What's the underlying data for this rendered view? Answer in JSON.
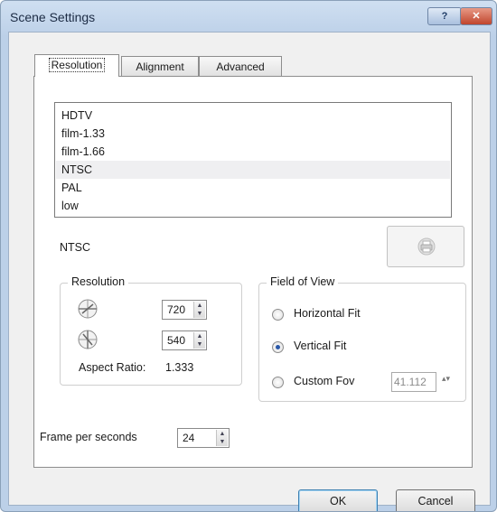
{
  "window": {
    "title": "Scene Settings",
    "help_label": "?",
    "close_label": "✕"
  },
  "tabs": [
    {
      "label": "Resolution",
      "selected": true
    },
    {
      "label": "Alignment",
      "selected": false
    },
    {
      "label": "Advanced",
      "selected": false
    }
  ],
  "presets": {
    "items": [
      "HDTV",
      "film-1.33",
      "film-1.66",
      "NTSC",
      "PAL",
      "low"
    ],
    "selected": "NTSC"
  },
  "selected_preset_name": "NTSC",
  "render_button_icon": "printer-icon",
  "resolution_group": {
    "legend": "Resolution",
    "width_icon": "horizontal-dial-icon",
    "height_icon": "vertical-dial-icon",
    "width": "720",
    "height": "540",
    "aspect_ratio_label": "Aspect Ratio:",
    "aspect_ratio_value": "1.333"
  },
  "fov_group": {
    "legend": "Field of View",
    "options": [
      "Horizontal Fit",
      "Vertical Fit",
      "Custom Fov"
    ],
    "selected": "Vertical Fit",
    "custom_fov_value": "41.112",
    "custom_fov_arrows": "▴▾"
  },
  "frame_rate": {
    "label": "Frame per seconds",
    "value": "24"
  },
  "spin_arrows": {
    "up": "▲",
    "down": "▼"
  },
  "buttons": {
    "ok": "OK",
    "cancel": "Cancel"
  },
  "colors": {
    "accent": "#2a58a8",
    "selection": "#efeff1",
    "title_bar": "#bcd0e8"
  }
}
